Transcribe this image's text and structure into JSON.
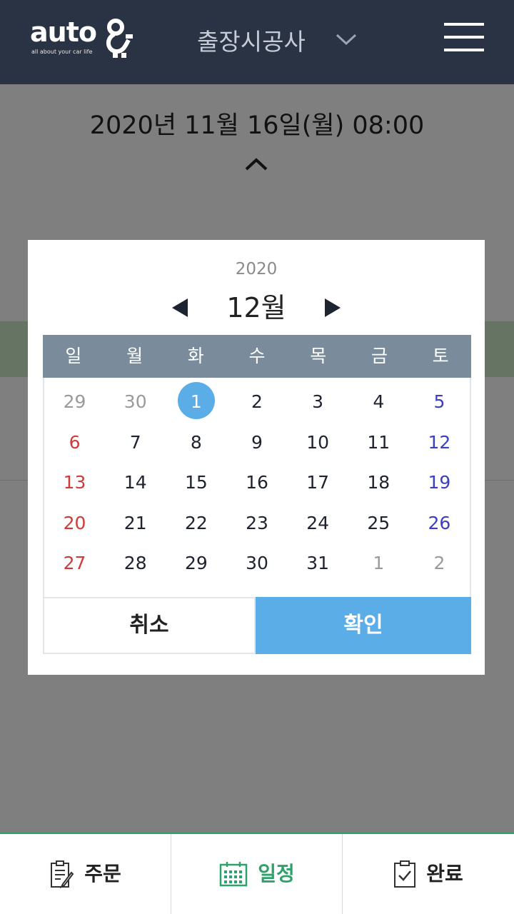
{
  "header": {
    "logo_text": "auto",
    "logo_sub": "all about your car life",
    "title": "출장시공사"
  },
  "page": {
    "datetime": "2020년  11월  16일(월)  08:00"
  },
  "picker": {
    "year": "2020",
    "month": "12월",
    "weekdays": [
      "일",
      "월",
      "화",
      "수",
      "목",
      "금",
      "토"
    ],
    "weeks": [
      [
        {
          "d": "29",
          "t": "dim"
        },
        {
          "d": "30",
          "t": "dim"
        },
        {
          "d": "1",
          "t": "sel"
        },
        {
          "d": "2",
          "t": ""
        },
        {
          "d": "3",
          "t": ""
        },
        {
          "d": "4",
          "t": ""
        },
        {
          "d": "5",
          "t": "sat"
        }
      ],
      [
        {
          "d": "6",
          "t": "sun"
        },
        {
          "d": "7",
          "t": ""
        },
        {
          "d": "8",
          "t": ""
        },
        {
          "d": "9",
          "t": ""
        },
        {
          "d": "10",
          "t": ""
        },
        {
          "d": "11",
          "t": ""
        },
        {
          "d": "12",
          "t": "sat"
        }
      ],
      [
        {
          "d": "13",
          "t": "sun"
        },
        {
          "d": "14",
          "t": ""
        },
        {
          "d": "15",
          "t": ""
        },
        {
          "d": "16",
          "t": ""
        },
        {
          "d": "17",
          "t": ""
        },
        {
          "d": "18",
          "t": ""
        },
        {
          "d": "19",
          "t": "sat"
        }
      ],
      [
        {
          "d": "20",
          "t": "sun"
        },
        {
          "d": "21",
          "t": ""
        },
        {
          "d": "22",
          "t": ""
        },
        {
          "d": "23",
          "t": ""
        },
        {
          "d": "24",
          "t": ""
        },
        {
          "d": "25",
          "t": ""
        },
        {
          "d": "26",
          "t": "sat"
        }
      ],
      [
        {
          "d": "27",
          "t": "sun"
        },
        {
          "d": "28",
          "t": ""
        },
        {
          "d": "29",
          "t": ""
        },
        {
          "d": "30",
          "t": ""
        },
        {
          "d": "31",
          "t": ""
        },
        {
          "d": "1",
          "t": "dim"
        },
        {
          "d": "2",
          "t": "dim"
        }
      ]
    ],
    "cancel_label": "취소",
    "ok_label": "확인"
  },
  "tabs": [
    {
      "label": "주문",
      "icon": "order-form-icon"
    },
    {
      "label": "일정",
      "icon": "calendar-icon",
      "active": true
    },
    {
      "label": "완료",
      "icon": "clipboard-check-icon"
    }
  ],
  "colors": {
    "header_bg": "#2a3343",
    "accent_blue": "#5bade8",
    "accent_green": "#2ea26a",
    "sunday": "#d23a3a",
    "saturday": "#3b3fc0"
  }
}
